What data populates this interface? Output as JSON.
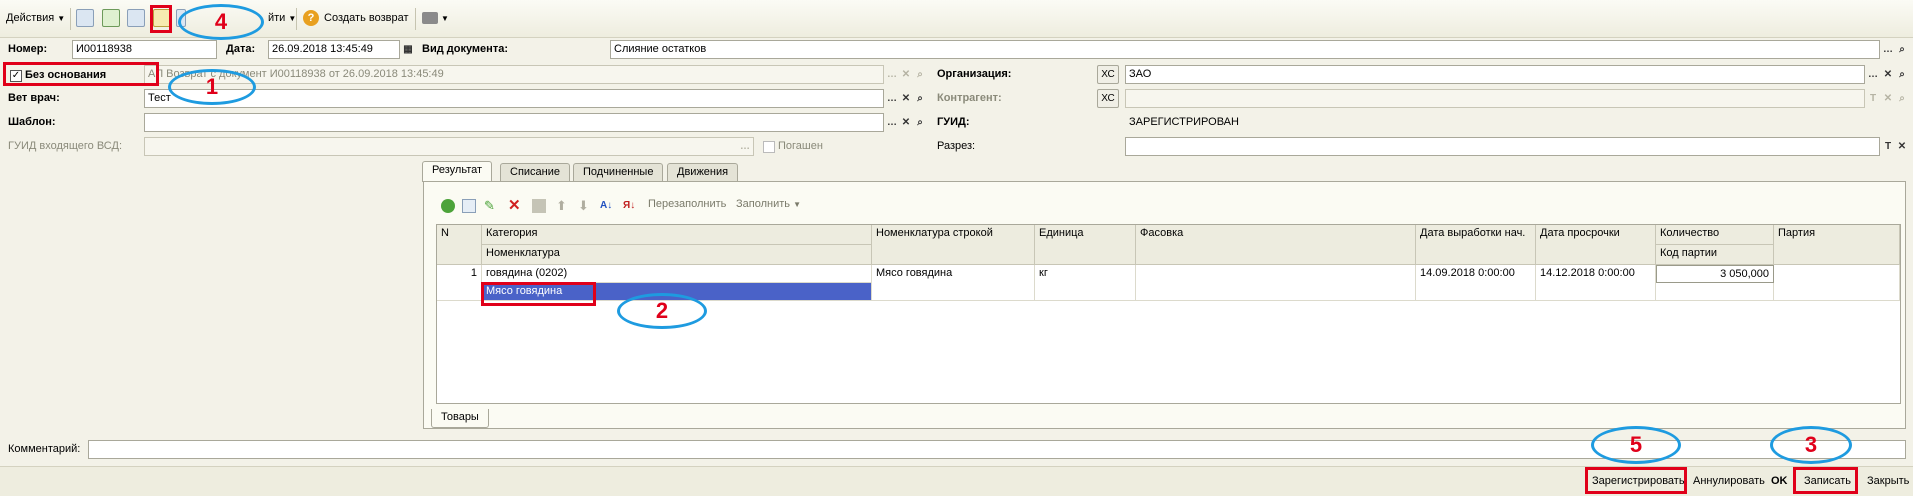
{
  "toolbar": {
    "actions_label": "Действия",
    "goto_label": "Перейти",
    "goto_prefix_hidden": "",
    "return_label": "Создать возврат",
    "goto_suffix": "йти"
  },
  "form": {
    "number_label": "Номер:",
    "number_value": "И00118938",
    "date_label": "Дата:",
    "date_value": "26.09.2018 13:45:49",
    "doctype_label": "Вид документа:",
    "doctype_value": "Слияние остатков",
    "no_basis_label": "Без основания",
    "no_basis_checked": "✓",
    "basis_value": "АП Возврат с документ И00118938 от 26.09.2018 13:45:49",
    "vet_label": "Вет врач:",
    "vet_value": "Тест",
    "template_label": "Шаблон:",
    "template_value": "",
    "guid_in_label": "ГУИД входящего ВСД:",
    "guid_in_value": "",
    "paid_label": "Погашен",
    "org_label": "Организация:",
    "org_xs": "ХС",
    "org_value": "ЗАО",
    "counterparty_label": "Контрагент:",
    "counterparty_xs": "ХС",
    "counterparty_value": "",
    "guid_label": "ГУИД:",
    "guid_value": "ЗАРЕГИСТРИРОВАН",
    "section_label": "Разрез:",
    "section_value": "",
    "comment_label": "Комментарий:",
    "comment_value": ""
  },
  "tabs": [
    {
      "label": "Результат",
      "active": true
    },
    {
      "label": "Списание",
      "active": false
    },
    {
      "label": "Подчиненные",
      "active": false
    },
    {
      "label": "Движения",
      "active": false
    }
  ],
  "grid_toolbar": {
    "refill_label": "Перезаполнить",
    "fill_label": "Заполнить"
  },
  "grid": {
    "headers": {
      "n": "N",
      "category": "Категория",
      "nomenclature": "Номенклатура",
      "row_nomenclature": "Номенклатура строкой",
      "unit": "Единица",
      "packing": "Фасовка",
      "prod_date": "Дата выработки нач.",
      "expiry": "Дата просрочки",
      "quantity": "Количество",
      "batch_code": "Код партии",
      "batch": "Партия"
    },
    "rows": [
      {
        "n": "1",
        "category": "говядина (0202)",
        "nomenclature": "Мясо говядина",
        "row_nomenclature": "Мясо говядина",
        "unit": "кг",
        "packing": "",
        "prod_date": "14.09.2018 0:00:00",
        "expiry": "14.12.2018 0:00:00",
        "quantity": "3 050,000",
        "batch_code": "",
        "batch": ""
      }
    ],
    "bottom_tab": "Товары"
  },
  "bottom": {
    "register": "Зарегистрировать",
    "annul": "Аннулировать",
    "ok": "OK",
    "save": "Записать",
    "close": "Закрыть"
  },
  "annotations": [
    "1",
    "2",
    "3",
    "4",
    "5"
  ],
  "colors": {
    "annotation_box": "#e0001a",
    "annotation_oval": "#1e9be0",
    "selection": "#4a62c8"
  }
}
